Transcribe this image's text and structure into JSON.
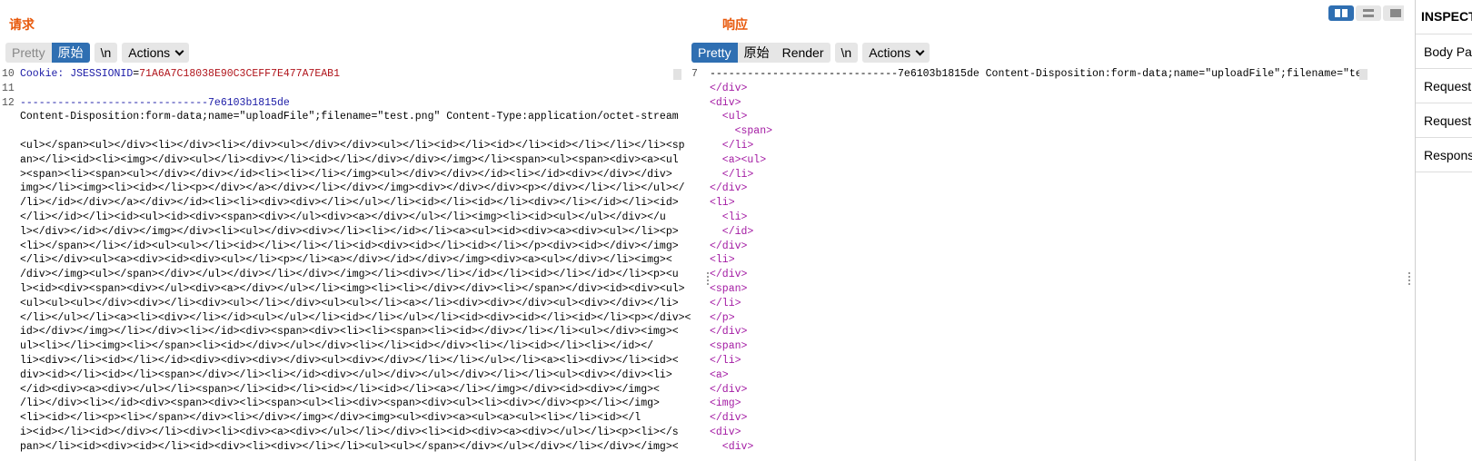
{
  "request": {
    "title": "请求",
    "tabs": {
      "pretty": "Pretty",
      "raw": "原始",
      "newline": "\\n",
      "actions": "Actions"
    },
    "lines": [
      {
        "num": "10",
        "parts": [
          {
            "t": "Cookie: ",
            "c": "blue"
          },
          {
            "t": "JSESSIONID",
            "c": "blue"
          },
          {
            "t": "=",
            "c": ""
          },
          {
            "t": "71A6A7C18038E90C3CEFF7E477A7EAB1",
            "c": "red"
          }
        ]
      },
      {
        "num": "11",
        "parts": []
      },
      {
        "num": "12",
        "parts": [
          {
            "t": "------------------------------7e6103b1815de",
            "c": "blue"
          }
        ]
      },
      {
        "num": "",
        "parts": [
          {
            "t": "Content-Disposition:form-data;name=\"uploadFile\";filename=\"test.png\" Content-Type:application/octet-stream",
            "c": ""
          }
        ]
      },
      {
        "num": "",
        "parts": []
      },
      {
        "num": "",
        "parts": [
          {
            "t": "<ul></span><ul></div><li></div><li></div><ul></div></div><ul></li><id></li><id></li><id></li></li></li><sp",
            "c": ""
          }
        ]
      },
      {
        "num": "",
        "parts": [
          {
            "t": "an></li><id><li><img></div><ul></li><div></li><id></li></div></div></img></li><span><ul><span><div><a><ul",
            "c": ""
          }
        ]
      },
      {
        "num": "",
        "parts": [
          {
            "t": "><span><li><span><ul></div></div></id><li><li></li></img><ul></div></div></id><li></id><div></div></div>",
            "c": ""
          }
        ]
      },
      {
        "num": "",
        "parts": [
          {
            "t": "img></li><img><li><id></li><p></div></a></div></li></div></img><div></div></div><p></div></li></li></ul></",
            "c": ""
          }
        ]
      },
      {
        "num": "",
        "parts": [
          {
            "t": "/li></id></div></a></div></id><li><li><div><div></li></ul></li><id></li><id></li><div></li></id></li><id>",
            "c": ""
          }
        ]
      },
      {
        "num": "",
        "parts": [
          {
            "t": "</li></id></li><id><ul><id><div><span><div></ul><div><a></div></ul></li><img><li><id><ul></ul></div></u",
            "c": ""
          }
        ]
      },
      {
        "num": "",
        "parts": [
          {
            "t": "l></div></id></div></img></div><li><ul></div><div></li><li></id></li><a><ul><id><div><a><div><ul></li><p>",
            "c": ""
          }
        ]
      },
      {
        "num": "",
        "parts": [
          {
            "t": "<li></span></li></id><ul><ul></li><id></li></li></li><id><div><id></li><id></li></p><div><id></div></img>",
            "c": ""
          }
        ]
      },
      {
        "num": "",
        "parts": [
          {
            "t": "</li></div><ul><a><div><id><div><ul></li><p></li><a></div></id></div></img><div><a><ul></div></li><img><",
            "c": ""
          }
        ]
      },
      {
        "num": "",
        "parts": [
          {
            "t": "/div></img><ul></span></div></ul></div></li></div></img></li><div></li></id></li><id></li></id></li><p><u",
            "c": ""
          }
        ]
      },
      {
        "num": "",
        "parts": [
          {
            "t": "l><id><div><span><div></ul><div><a></div></ul></li><img><li><li></div></div><li></span></div><id><div><ul>",
            "c": ""
          }
        ]
      },
      {
        "num": "",
        "parts": [
          {
            "t": "<ul><ul><ul></div><div></li><div><ul></li></div><ul><ul></li><a></li><div><div></div><ul><div></div></li>",
            "c": ""
          }
        ]
      },
      {
        "num": "",
        "parts": [
          {
            "t": "</li></ul></li><a><li><div></li></id><ul></ul></li><id></li></ul></li><id><div><id></li><id></li><p></div><",
            "c": ""
          }
        ]
      },
      {
        "num": "",
        "parts": [
          {
            "t": "id></div></img></li></div><li></id><div><span><div><li><li><span><li><id></div></li></li><ul></div><img><",
            "c": ""
          }
        ]
      },
      {
        "num": "",
        "parts": [
          {
            "t": "ul><li></li><img><li></span><li><id></div></ul></div><li></li><id></div><li></li><id></li><li></id></",
            "c": ""
          }
        ]
      },
      {
        "num": "",
        "parts": [
          {
            "t": "li><div></li><id></li></id><div><div><div></div><ul><div></div></li></li></ul></li><a><li><div></li><id><",
            "c": ""
          }
        ]
      },
      {
        "num": "",
        "parts": [
          {
            "t": "div><id></li><id></li><span></div></li><li></id><div></ul></div></ul></div></li></li><ul><div></div><li>",
            "c": ""
          }
        ]
      },
      {
        "num": "",
        "parts": [
          {
            "t": "</id><div><a><div></ul></li><span></li><id></li><id></li><id></li><a></li></img></div><id><div></img><",
            "c": ""
          }
        ]
      },
      {
        "num": "",
        "parts": [
          {
            "t": "/li></div><li></id><div><span><div><li><span><ul><li><div><span><div><ul><li><div></div><p></li></img>",
            "c": ""
          }
        ]
      },
      {
        "num": "",
        "parts": [
          {
            "t": "<li><id></li><p><li></span></div><li></div></img></div><img><ul><div><a><ul><a><ul><li></li><id></l",
            "c": ""
          }
        ]
      },
      {
        "num": "",
        "parts": [
          {
            "t": "i><id></li><id></div></li><div><li><div><a><div></ul></li></div><li><id><div><a><div></ul></li><p><li></s",
            "c": ""
          }
        ]
      },
      {
        "num": "",
        "parts": [
          {
            "t": "pan></li><id><div><id></li><id><div><li><div></li></li><ul><ul></span></div></ul></div></li></div></img><",
            "c": ""
          }
        ]
      }
    ]
  },
  "response": {
    "title": "响应",
    "tabs": {
      "pretty": "Pretty",
      "raw": "原始",
      "render": "Render",
      "newline": "\\n",
      "actions": "Actions"
    },
    "lines": [
      {
        "num": "7",
        "parts": [
          {
            "t": "------------------------------7e6103b1815de Content-Disposition:form-data;name=\"uploadFile\";filename=\"test.:",
            "c": ""
          }
        ]
      },
      {
        "num": "",
        "parts": [
          {
            "t": "</div>",
            "c": "tag"
          }
        ]
      },
      {
        "num": "",
        "parts": [
          {
            "t": "<div>",
            "c": "tag"
          }
        ]
      },
      {
        "num": "",
        "parts": [
          {
            "t": "  <ul>",
            "c": "tag"
          }
        ]
      },
      {
        "num": "",
        "parts": [
          {
            "t": "    <span>",
            "c": "tag"
          }
        ]
      },
      {
        "num": "",
        "parts": [
          {
            "t": "  </li>",
            "c": "tag"
          }
        ]
      },
      {
        "num": "",
        "parts": [
          {
            "t": "  <a><ul>",
            "c": "tag"
          }
        ]
      },
      {
        "num": "",
        "parts": [
          {
            "t": "  </li>",
            "c": "tag"
          }
        ]
      },
      {
        "num": "",
        "parts": [
          {
            "t": "</div>",
            "c": "tag"
          }
        ]
      },
      {
        "num": "",
        "parts": [
          {
            "t": "<li>",
            "c": "tag"
          }
        ]
      },
      {
        "num": "",
        "parts": [
          {
            "t": "  <li>",
            "c": "tag"
          }
        ]
      },
      {
        "num": "",
        "parts": [
          {
            "t": "  </id>",
            "c": "tag"
          }
        ]
      },
      {
        "num": "",
        "parts": [
          {
            "t": "</div>",
            "c": "tag"
          }
        ]
      },
      {
        "num": "",
        "parts": [
          {
            "t": "<li>",
            "c": "tag"
          }
        ]
      },
      {
        "num": "",
        "parts": [
          {
            "t": "</div>",
            "c": "tag"
          }
        ]
      },
      {
        "num": "",
        "parts": [
          {
            "t": "<span>",
            "c": "tag"
          }
        ]
      },
      {
        "num": "",
        "parts": [
          {
            "t": "</li>",
            "c": "tag"
          }
        ]
      },
      {
        "num": "",
        "parts": [
          {
            "t": "</p>",
            "c": "tag"
          }
        ]
      },
      {
        "num": "",
        "parts": [
          {
            "t": "</div>",
            "c": "tag"
          }
        ]
      },
      {
        "num": "",
        "parts": [
          {
            "t": "<span>",
            "c": "tag"
          }
        ]
      },
      {
        "num": "",
        "parts": [
          {
            "t": "</li>",
            "c": "tag"
          }
        ]
      },
      {
        "num": "",
        "parts": [
          {
            "t": "<a>",
            "c": "tag"
          }
        ]
      },
      {
        "num": "",
        "parts": [
          {
            "t": "</div>",
            "c": "tag"
          }
        ]
      },
      {
        "num": "",
        "parts": [
          {
            "t": "<img>",
            "c": "tag"
          }
        ]
      },
      {
        "num": "",
        "parts": [
          {
            "t": "</div>",
            "c": "tag"
          }
        ]
      },
      {
        "num": "",
        "parts": [
          {
            "t": "<div>",
            "c": "tag"
          }
        ]
      },
      {
        "num": "",
        "parts": [
          {
            "t": "  <div>",
            "c": "tag"
          }
        ]
      }
    ]
  },
  "layout_icons": [
    "split-horizontal-icon",
    "split-vertical-icon",
    "single-pane-icon"
  ],
  "inspector": {
    "title": "INSPECTOR",
    "items": [
      "Body Parameters",
      "Request Attributes",
      "Request Headers",
      "Response Headers"
    ]
  },
  "colors": {
    "accent": "#e8590c",
    "selected_tab": "#2f6fb2",
    "keyword": "#1a1aa6",
    "value": "#b0141b",
    "tag": "#a31aa3"
  }
}
